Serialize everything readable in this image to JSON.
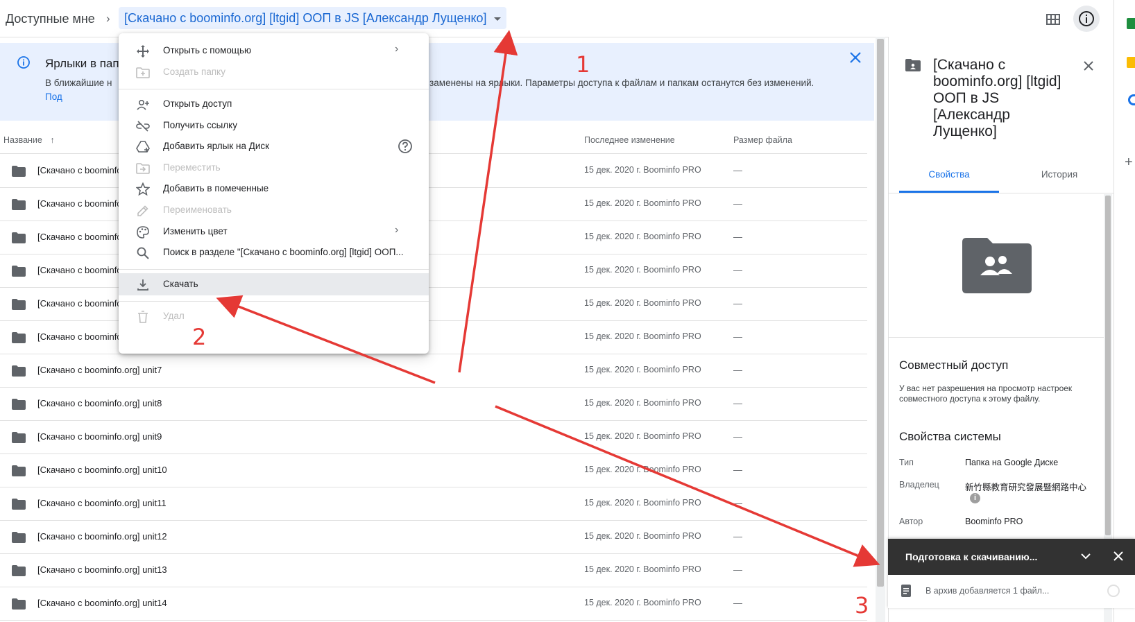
{
  "header": {
    "breadcrumb_root": "Доступные мне",
    "breadcrumb_current": "[Скачано с boominfo.org] [ltgid] ООП в JS [Александр Лущенко]"
  },
  "banner": {
    "title": "Ярлыки в пап",
    "body": "В ближайшие н                                                                                                            х, будут заменены на ярлыки. Параметры доступа к файлам и папкам останутся без изменений.",
    "link": "Под"
  },
  "table": {
    "headers": {
      "name": "Название",
      "modified": "Последнее изменение",
      "size": "Размер файла"
    },
    "rows": [
      {
        "name": "[Скачано с boominfo",
        "modified": "15 дек. 2020 г. Boominfo PRO",
        "size": "—"
      },
      {
        "name": "[Скачано с boominfo",
        "modified": "15 дек. 2020 г. Boominfo PRO",
        "size": "—"
      },
      {
        "name": "[Скачано с boominfo",
        "modified": "15 дек. 2020 г. Boominfo PRO",
        "size": "—"
      },
      {
        "name": "[Скачано с boominfo",
        "modified": "15 дек. 2020 г. Boominfo PRO",
        "size": "—"
      },
      {
        "name": "[Скачано с boominfo",
        "modified": "15 дек. 2020 г. Boominfo PRO",
        "size": "—"
      },
      {
        "name": "[Скачано с boominfo",
        "modified": "15 дек. 2020 г. Boominfo PRO",
        "size": "—"
      },
      {
        "name": "[Скачано с boominfo.org] unit7",
        "modified": "15 дек. 2020 г. Boominfo PRO",
        "size": "—"
      },
      {
        "name": "[Скачано с boominfo.org] unit8",
        "modified": "15 дек. 2020 г. Boominfo PRO",
        "size": "—"
      },
      {
        "name": "[Скачано с boominfo.org] unit9",
        "modified": "15 дек. 2020 г. Boominfo PRO",
        "size": "—"
      },
      {
        "name": "[Скачано с boominfo.org] unit10",
        "modified": "15 дек. 2020 г. Boominfo PRO",
        "size": "—"
      },
      {
        "name": "[Скачано с boominfo.org] unit11",
        "modified": "15 дек. 2020 г. Boominfo PRO",
        "size": "—"
      },
      {
        "name": "[Скачано с boominfo.org] unit12",
        "modified": "15 дек. 2020 г. Boominfo PRO",
        "size": "—"
      },
      {
        "name": "[Скачано с boominfo.org] unit13",
        "modified": "15 дек. 2020 г. Boominfo PRO",
        "size": "—"
      },
      {
        "name": "[Скачано с boominfo.org] unit14",
        "modified": "15 дек. 2020 г. Boominfo PRO",
        "size": "—"
      }
    ]
  },
  "menu": {
    "items": [
      {
        "label": "Открыть с помощью",
        "icon": "move-icon",
        "disabled": false,
        "submenu": true
      },
      {
        "label": "Создать папку",
        "icon": "new-folder-icon",
        "disabled": true,
        "submenu": false
      },
      {
        "label": "Открыть доступ",
        "icon": "person-add-icon",
        "disabled": false,
        "submenu": false
      },
      {
        "label": "Получить ссылку",
        "icon": "link-icon",
        "disabled": false,
        "submenu": false
      },
      {
        "label": "Добавить ярлык на Диск",
        "icon": "drive-shortcut-icon",
        "disabled": false,
        "submenu": false,
        "help": true
      },
      {
        "label": "Переместить",
        "icon": "move-to-icon",
        "disabled": true,
        "submenu": false
      },
      {
        "label": "Добавить в помеченные",
        "icon": "star-icon",
        "disabled": false,
        "submenu": false
      },
      {
        "label": "Переименовать",
        "icon": "edit-icon",
        "disabled": true,
        "submenu": false
      },
      {
        "label": "Изменить цвет",
        "icon": "palette-icon",
        "disabled": false,
        "submenu": true
      },
      {
        "label": "Поиск в разделе \"[Скачано с boominfo.org] [ltgid] ООП...",
        "icon": "search-icon",
        "disabled": false,
        "submenu": false
      },
      {
        "label": "Скачать",
        "icon": "download-icon",
        "disabled": false,
        "submenu": false,
        "highlighted": true
      },
      {
        "label": "Удал",
        "icon": "trash-icon",
        "disabled": true,
        "submenu": false
      }
    ]
  },
  "panel": {
    "title": "[Скачано с boominfo.org] [ltgid] ООП в JS [Александр Лущенко]",
    "tabs": [
      "Свойства",
      "История"
    ],
    "share_title": "Совместный доступ",
    "share_body": "У вас нет разрешения на просмотр настроек совместного доступа к этому файлу.",
    "system_title": "Свойства системы",
    "props": [
      {
        "key": "Тип",
        "value": "Папка на Google Диске"
      },
      {
        "key": "Владелец",
        "value": "新竹縣教育研究發展暨網路中心"
      },
      {
        "key": "Автор",
        "value": "Boominfo PRO"
      }
    ]
  },
  "toast": {
    "title": "Подготовка к скачиванию...",
    "item": "В архив добавляется 1 файл..."
  },
  "annotations": {
    "label1": "1",
    "label2": "2",
    "label3": "3",
    "color": "#e53935"
  },
  "colors": {
    "accent": "#1a73e8",
    "banner_bg": "#e8f0fe",
    "toast_bg": "#323232"
  }
}
